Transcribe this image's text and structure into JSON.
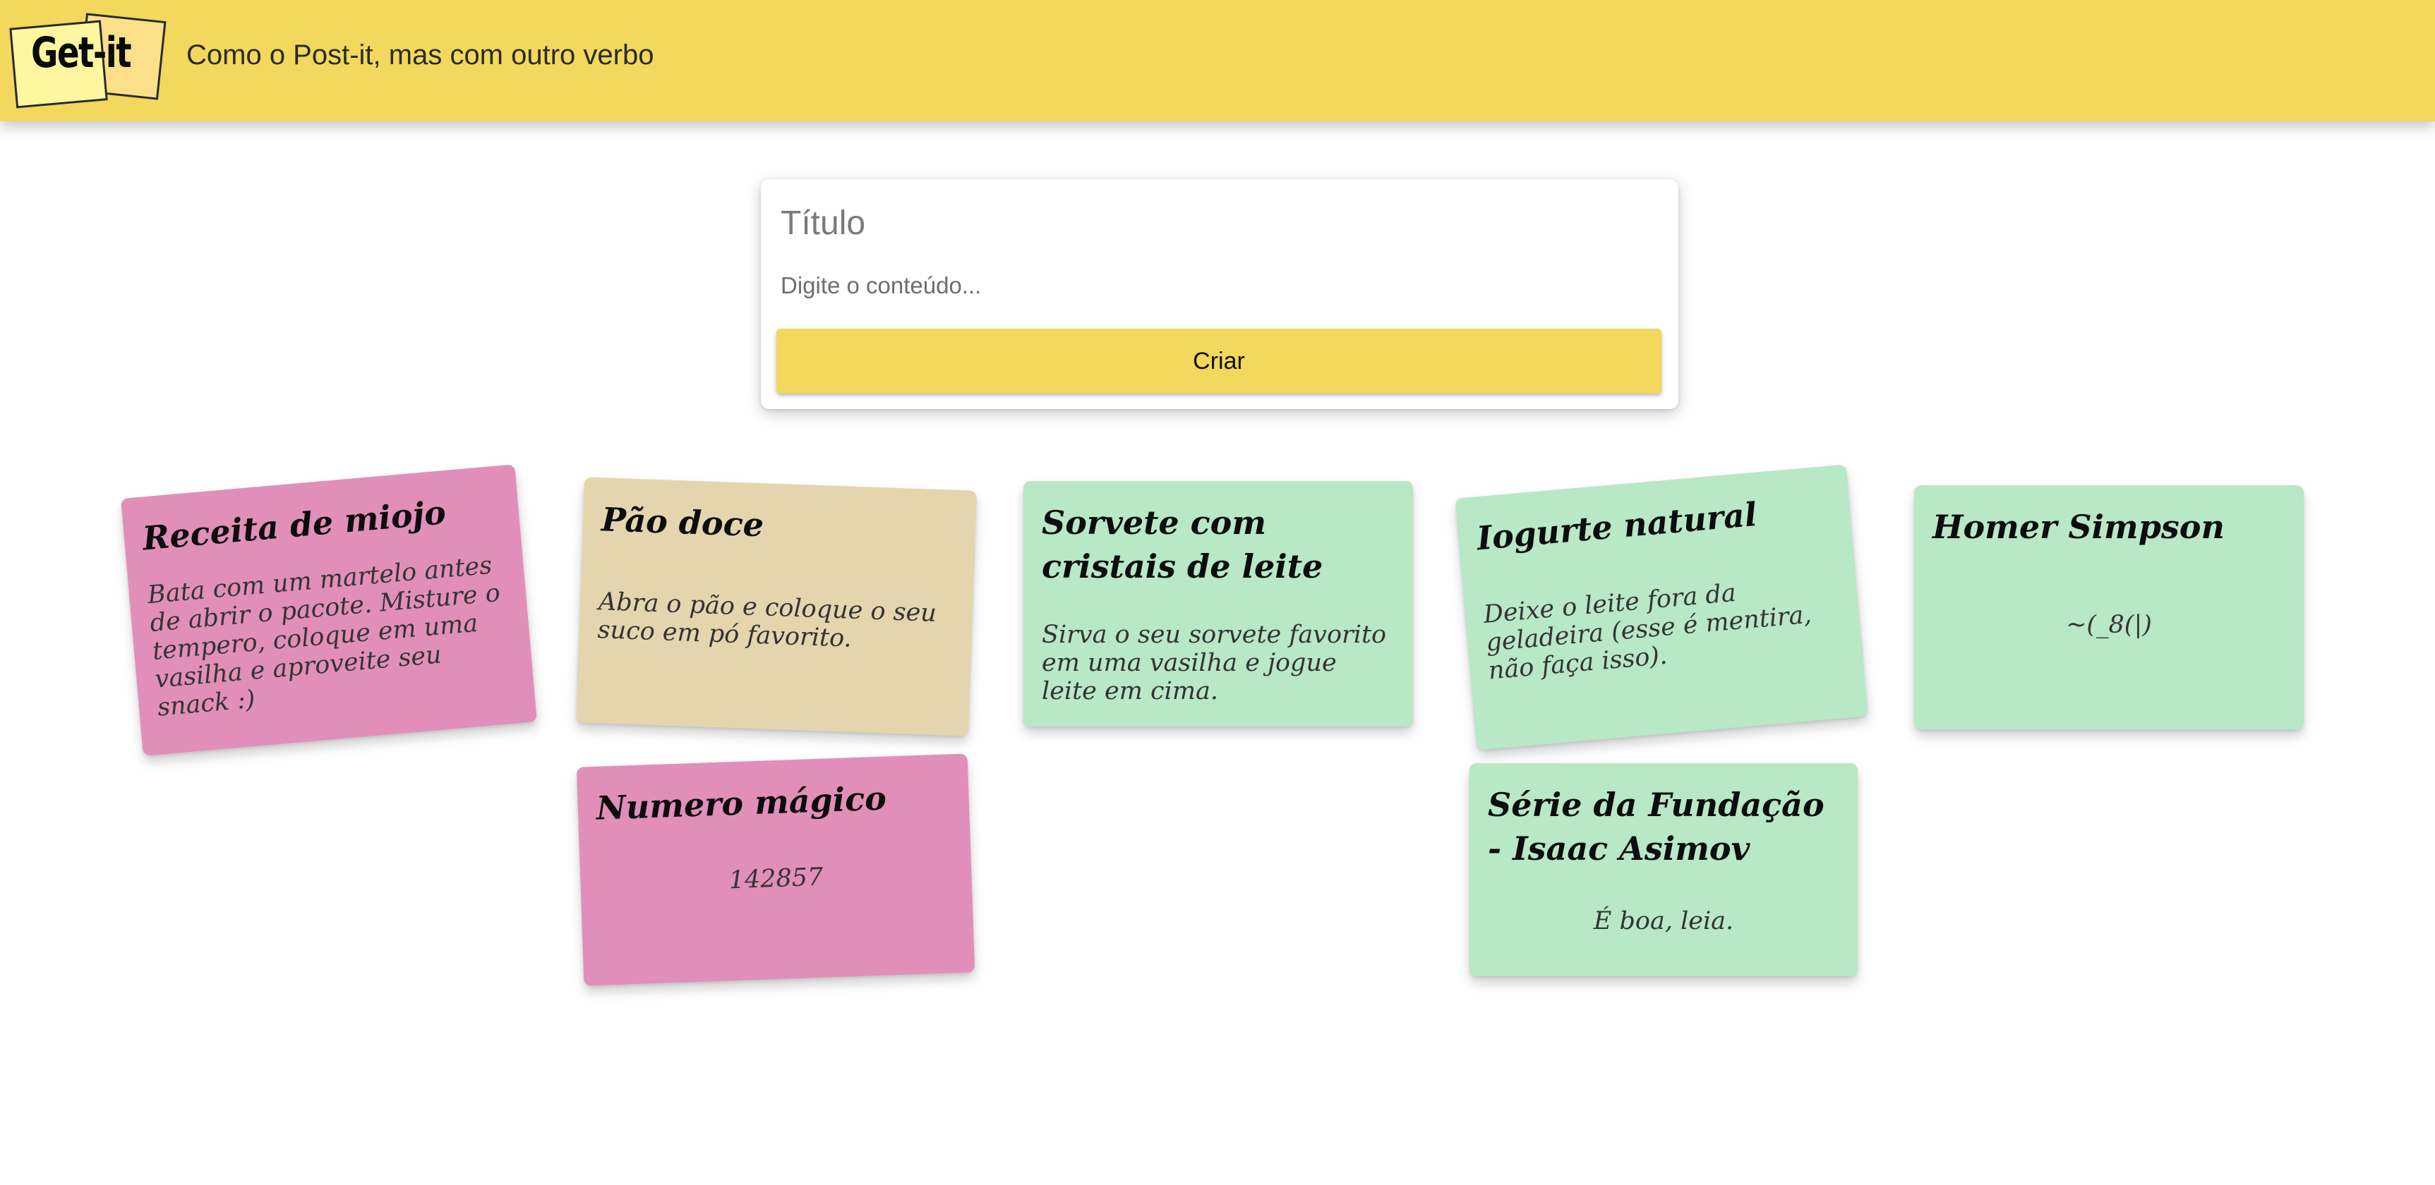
{
  "app": {
    "logo_text": "Get-it",
    "tagline": "Como o Post-it, mas com outro verbo"
  },
  "form": {
    "title_placeholder": "Título",
    "content_placeholder": "Digite o conteúdo...",
    "create_label": "Criar"
  },
  "colors": {
    "header": "#f2d85c",
    "button": "#f2d85c",
    "note_pink": "#e18fb8",
    "note_tan": "#e5d5ae",
    "note_green": "#b8e8c6"
  },
  "notes": [
    {
      "title": "Receita de miojo",
      "content": "Bata com um martelo antes de abrir o pacote. Misture o tempero, coloque em uma vasilha e aproveite seu snack :)",
      "color": "pink"
    },
    {
      "title": "Pão doce",
      "content": "Abra o pão e coloque o seu suco em pó favorito.",
      "color": "tan"
    },
    {
      "title": "Sorvete com cristais de leite",
      "content": "Sirva o seu sorvete favorito em uma vasilha e jogue leite em cima.",
      "color": "green"
    },
    {
      "title": "Iogurte natural",
      "content": "Deixe o leite fora da geladeira (esse é mentira, não faça isso).",
      "color": "green"
    },
    {
      "title": "Homer Simpson",
      "content": "~(_8(|)",
      "color": "green"
    },
    {
      "title": "Numero mágico",
      "content": "142857",
      "color": "pink"
    },
    {
      "title": "Série da Fundação - Isaac Asimov",
      "content": "É boa, leia.",
      "color": "green"
    }
  ]
}
